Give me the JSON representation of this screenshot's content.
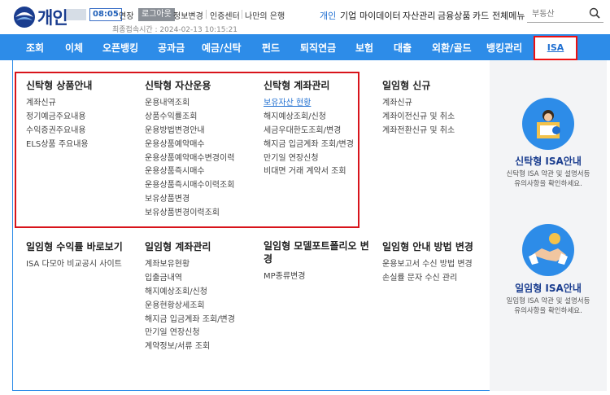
{
  "header": {
    "brand": "개인",
    "session_timer": "08:05",
    "extend_label": "연장",
    "logout_label": "로그아웃",
    "util_links": [
      "정보변경",
      "인증센터",
      "나만의 은행"
    ],
    "last_login": "최종접속시간 : 2024-02-13 10:15:21",
    "top_nav": [
      "개인",
      "기업",
      "마이데이터",
      "자산관리",
      "금융상품",
      "카드",
      "전체메뉴"
    ],
    "search_placeholder": "부동산"
  },
  "gnb": {
    "items": [
      "조회",
      "이체",
      "오픈뱅킹",
      "공과금",
      "예금/신탁",
      "펀드",
      "퇴직연금",
      "보험",
      "대출",
      "외환/골드",
      "뱅킹관리"
    ],
    "active": "ISA"
  },
  "menu": {
    "col1": {
      "title": "신탁형 상품안내",
      "items": [
        "계좌신규",
        "정기예금주요내용",
        "수익증권주요내용",
        "ELS상품 주요내용"
      ]
    },
    "col2": {
      "title": "신탁형 자산운용",
      "items": [
        "운용내역조회",
        "상품수익률조회",
        "운용방법변경안내",
        "운용상품예약매수",
        "운용상품예약매수변경이력",
        "운용상품즉시매수",
        "운용상품즉시매수이력조회",
        "보유상품변경",
        "보유상품변경이력조회"
      ]
    },
    "col3": {
      "title": "신탁형 계좌관리",
      "items": [
        "보유자산 현황",
        "해지예상조회/신청",
        "세금우대한도조회/변경",
        "해지금 입금계좌 조회/변경",
        "만기일 연장신청",
        "비대면 거래 계약서 조회"
      ]
    },
    "col4": {
      "title": "일임형 신규",
      "items": [
        "계좌신규",
        "계좌이전신규 및 취소",
        "계좌전환신규 및 취소"
      ]
    },
    "col5": {
      "title": "일임형 수익률 바로보기",
      "items": [
        "ISA 다모아 비교공시 사이트"
      ]
    },
    "col6": {
      "title": "일임형 계좌관리",
      "items": [
        "계좌보유현황",
        "입출금내역",
        "해지예상조회/신청",
        "운용현황상세조회",
        "해지금 입금계좌 조회/변경",
        "만기일 연장신청",
        "계약정보/서류 조회"
      ]
    },
    "col7": {
      "title": "일임형 모델포트폴리오 변경",
      "items": [
        "MP종류변경"
      ]
    },
    "col8": {
      "title": "일임형 안내 방법 변경",
      "items": [
        "운용보고서 수신 방법 변경",
        "손실률 문자 수신 관리"
      ]
    }
  },
  "promo": [
    {
      "title": "신탁형 ISA안내",
      "desc1": "신탁형 ISA 약관 및 설명서등",
      "desc2": "유의사항을 확인하세요."
    },
    {
      "title": "일임형 ISA안내",
      "desc1": "일임형 ISA 약관 및 설명서등",
      "desc2": "유의사항을 확인하세요."
    }
  ],
  "colors": {
    "brand_blue": "#2d8ce8",
    "highlight_red": "#d8141b",
    "link_blue": "#1f6fd1"
  }
}
